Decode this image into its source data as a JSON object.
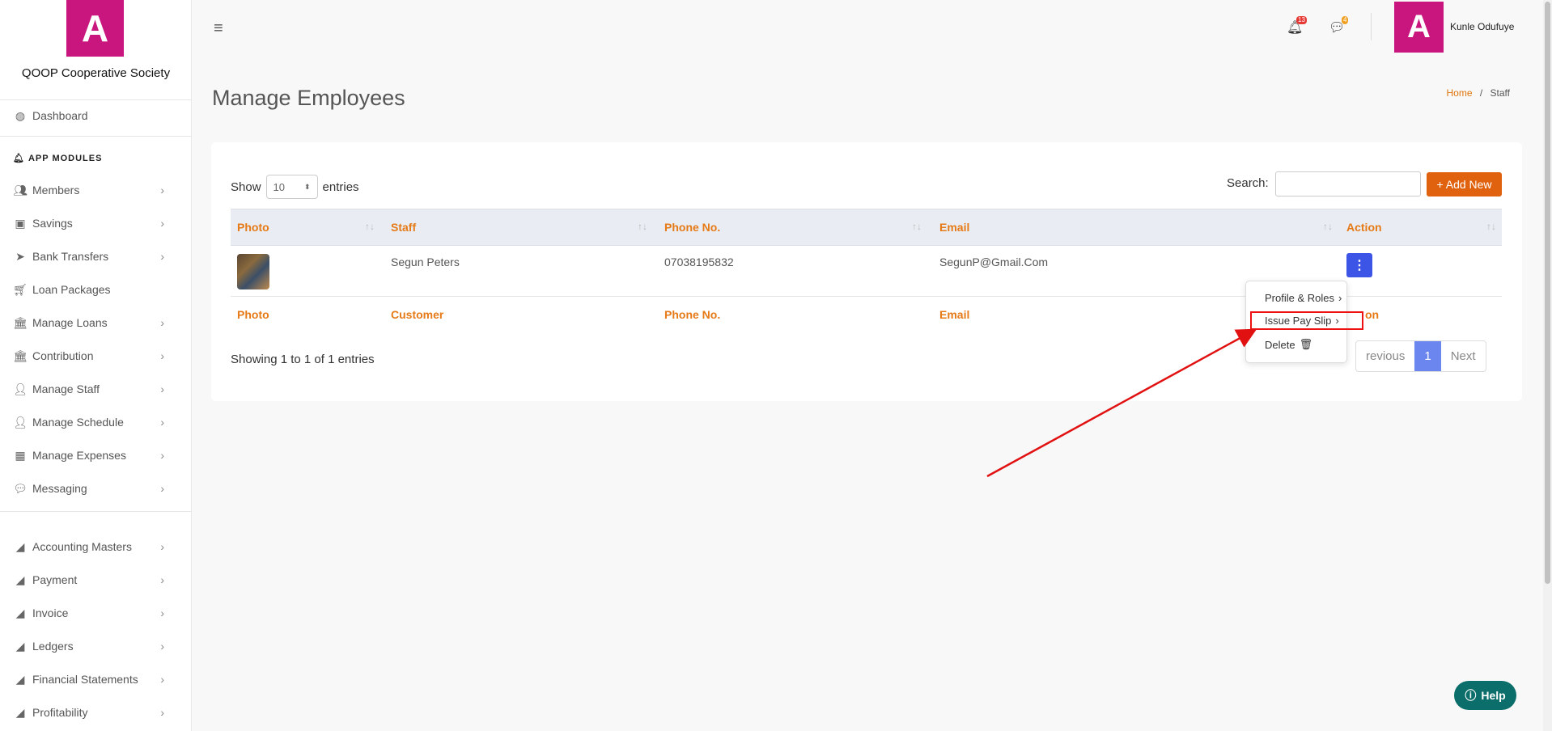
{
  "app": {
    "logo_letter": "A",
    "org_name": "QOOP Cooperative Society"
  },
  "sidebar": {
    "dashboard": "Dashboard",
    "section_heading": "APP MODULES",
    "items": [
      {
        "label": "Members",
        "icon": "users-icon"
      },
      {
        "label": "Savings",
        "icon": "money-icon"
      },
      {
        "label": "Bank Transfers",
        "icon": "paper-plane-icon"
      },
      {
        "label": "Loan Packages",
        "icon": "cart-icon"
      },
      {
        "label": "Manage Loans",
        "icon": "bank-icon"
      },
      {
        "label": "Contribution",
        "icon": "bank-icon"
      },
      {
        "label": "Manage Staff",
        "icon": "user-icon"
      },
      {
        "label": "Manage Schedule",
        "icon": "user-icon"
      },
      {
        "label": "Manage Expenses",
        "icon": "calculator-icon"
      },
      {
        "label": "Messaging",
        "icon": "comments-icon"
      }
    ],
    "items2": [
      {
        "label": "Accounting Masters",
        "icon": "chart-area-icon"
      },
      {
        "label": "Payment",
        "icon": "chart-area-icon"
      },
      {
        "label": "Invoice",
        "icon": "chart-area-icon"
      },
      {
        "label": "Ledgers",
        "icon": "chart-area-icon"
      },
      {
        "label": "Financial Statements",
        "icon": "chart-area-icon"
      },
      {
        "label": "Profitability",
        "icon": "chart-area-icon"
      }
    ]
  },
  "topbar": {
    "notifications_count": "13",
    "messages_count": "4",
    "avatar_letter": "A",
    "user_name": "Kunle Odufuye",
    "badge_red": "#e53935",
    "badge_orange": "#f0a020"
  },
  "page": {
    "title": "Manage Employees",
    "breadcrumb_home": "Home",
    "breadcrumb_sep": "/",
    "breadcrumb_current": "Staff"
  },
  "table": {
    "show_label": "Show",
    "page_size": "10",
    "entries_label": "entries",
    "search_label": "Search:",
    "add_new": "+ Add New",
    "headers": [
      "Photo",
      "Staff",
      "Phone No.",
      "Email",
      "Action"
    ],
    "footers": [
      "Photo",
      "Customer",
      "Phone No.",
      "Email",
      "on"
    ],
    "rows": [
      {
        "staff": "Segun Peters",
        "phone": "07038195832",
        "email": "SegunP@Gmail.Com",
        "action": "⋮"
      }
    ],
    "showing": "Showing 1 to 1 of 1 entries",
    "pager": {
      "previous": "revious",
      "current": "1",
      "next": "Next"
    }
  },
  "dropdown": {
    "items": [
      "Profile & Roles",
      "Issue Pay Slip",
      "Delete"
    ]
  },
  "help": "Help",
  "colors": {
    "accent": "#e0620f",
    "brand": "#c9167e",
    "action": "#3d55e6",
    "annotation": "#e11111"
  }
}
